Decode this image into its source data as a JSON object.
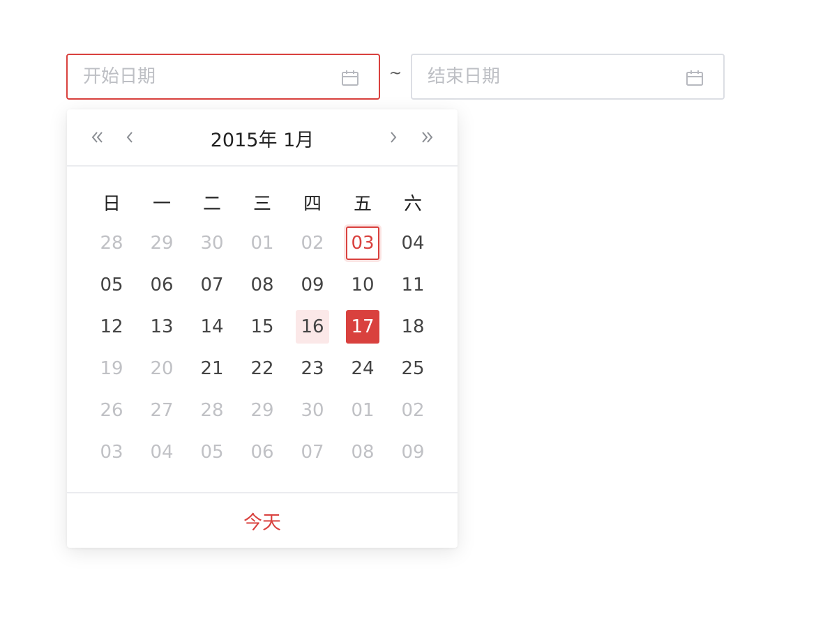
{
  "range_picker": {
    "start_placeholder": "开始日期",
    "end_placeholder": "结束日期",
    "separator": "~"
  },
  "calendar": {
    "year_label": "2015年",
    "month_label": "1月",
    "weekdays": [
      "日",
      "一",
      "二",
      "三",
      "四",
      "五",
      "六"
    ],
    "weeks": [
      [
        {
          "d": "28",
          "s": "other"
        },
        {
          "d": "29",
          "s": "other"
        },
        {
          "d": "30",
          "s": "other"
        },
        {
          "d": "01",
          "s": "other"
        },
        {
          "d": "02",
          "s": "other"
        },
        {
          "d": "03",
          "s": "today"
        },
        {
          "d": "04",
          "s": ""
        }
      ],
      [
        {
          "d": "05",
          "s": ""
        },
        {
          "d": "06",
          "s": ""
        },
        {
          "d": "07",
          "s": ""
        },
        {
          "d": "08",
          "s": ""
        },
        {
          "d": "09",
          "s": ""
        },
        {
          "d": "10",
          "s": ""
        },
        {
          "d": "11",
          "s": ""
        }
      ],
      [
        {
          "d": "12",
          "s": ""
        },
        {
          "d": "13",
          "s": ""
        },
        {
          "d": "14",
          "s": ""
        },
        {
          "d": "15",
          "s": ""
        },
        {
          "d": "16",
          "s": "in-range"
        },
        {
          "d": "17",
          "s": "selected"
        },
        {
          "d": "18",
          "s": ""
        }
      ],
      [
        {
          "d": "19",
          "s": "other"
        },
        {
          "d": "20",
          "s": "other"
        },
        {
          "d": "21",
          "s": ""
        },
        {
          "d": "22",
          "s": ""
        },
        {
          "d": "23",
          "s": ""
        },
        {
          "d": "24",
          "s": ""
        },
        {
          "d": "25",
          "s": ""
        }
      ],
      [
        {
          "d": "26",
          "s": "other"
        },
        {
          "d": "27",
          "s": "other"
        },
        {
          "d": "28",
          "s": "other"
        },
        {
          "d": "29",
          "s": "other"
        },
        {
          "d": "30",
          "s": "other"
        },
        {
          "d": "01",
          "s": "other"
        },
        {
          "d": "02",
          "s": "other"
        }
      ],
      [
        {
          "d": "03",
          "s": "other"
        },
        {
          "d": "04",
          "s": "other"
        },
        {
          "d": "05",
          "s": "other"
        },
        {
          "d": "06",
          "s": "other"
        },
        {
          "d": "07",
          "s": "other"
        },
        {
          "d": "08",
          "s": "other"
        },
        {
          "d": "09",
          "s": "other"
        }
      ]
    ],
    "today_button": "今天"
  },
  "icons": {
    "calendar": "calendar-icon",
    "prev_year": "double-chevron-left-icon",
    "prev_month": "chevron-left-icon",
    "next_month": "chevron-right-icon",
    "next_year": "double-chevron-right-icon"
  },
  "colors": {
    "accent": "#d9413e",
    "range_bg": "#fbe8e8",
    "muted": "#c0c1c5",
    "border": "#dcdee4"
  }
}
